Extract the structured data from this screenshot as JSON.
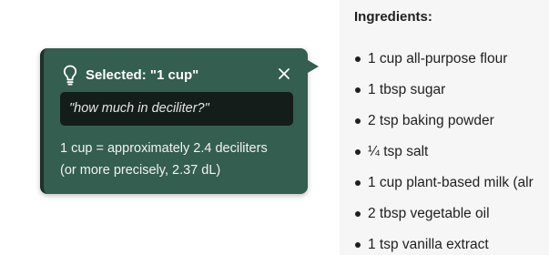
{
  "document": {
    "heading": "Ingredients:",
    "items": [
      {
        "label": "1 cup all-purpose flour"
      },
      {
        "label": "1 tbsp sugar"
      },
      {
        "label": "2 tsp baking powder"
      },
      {
        "label": "¼ tsp salt"
      },
      {
        "label": "1 cup plant-based milk (alr"
      },
      {
        "label": "2 tbsp vegetable oil"
      },
      {
        "label": "1 tsp vanilla extract"
      }
    ]
  },
  "popover": {
    "title": "Selected: \"1 cup\"",
    "query": "\"how much in deciliter?\"",
    "answer_line1": "1 cup = approximately 2.4 deciliters",
    "answer_line2": "(or more precisely, 2.37 dL)",
    "bulb_icon": "lightbulb-icon",
    "close_icon": "close-icon",
    "accent_color": "#345e4f",
    "query_bg_color": "#141d1a"
  }
}
